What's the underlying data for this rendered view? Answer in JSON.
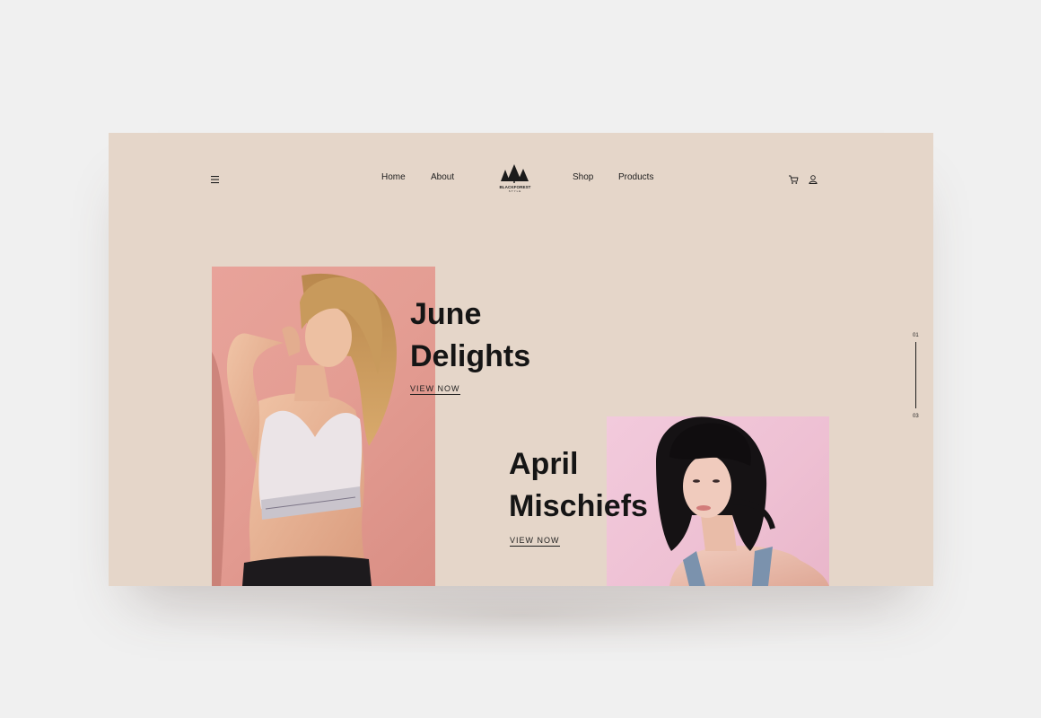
{
  "header": {
    "menu_icon": "hamburger-icon",
    "nav_left": [
      "Home",
      "About"
    ],
    "nav_right": [
      "Shop",
      "Products"
    ],
    "logo": {
      "name": "BLACKFOREST",
      "tagline": "STYLE",
      "icon": "pine-trees-logo"
    },
    "cart_icon": "cart-icon",
    "user_icon": "user-icon"
  },
  "slides": [
    {
      "title_line1": "June",
      "title_line2": "Delights",
      "cta": "VIEW NOW",
      "image": "model-in-white-sports-bra"
    },
    {
      "title_line1": "April",
      "title_line2": "Mischiefs",
      "cta": "VIEW NOW",
      "image": "model-with-black-bob-hair"
    }
  ],
  "indicator": {
    "current": "01",
    "total": "03"
  },
  "colors": {
    "background": "#f0f0f0",
    "hero": "#e5d6c9",
    "text": "#151515",
    "photo1": "#e49d93",
    "photo2": "#eec0d3"
  }
}
